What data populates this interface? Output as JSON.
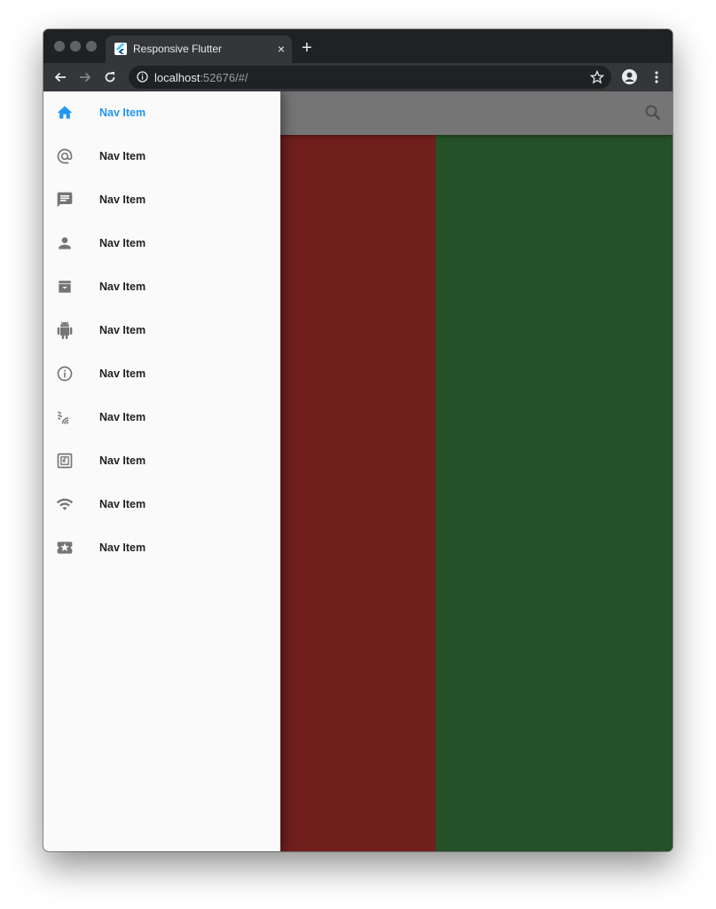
{
  "browser": {
    "tab_title": "Responsive Flutter",
    "tab_close": "×",
    "new_tab": "+",
    "url_host": "localhost",
    "url_rest": ":52676/#/"
  },
  "colors": {
    "accent": "#2196f3",
    "panel_red": "#701f1c",
    "panel_green": "#245127",
    "appbar": "#757575"
  },
  "drawer": {
    "items": [
      {
        "label": "Nav Item",
        "icon": "home-icon",
        "active": true
      },
      {
        "label": "Nav Item",
        "icon": "at-sign-icon"
      },
      {
        "label": "Nav Item",
        "icon": "chat-icon"
      },
      {
        "label": "Nav Item",
        "icon": "person-icon"
      },
      {
        "label": "Nav Item",
        "icon": "archive-icon"
      },
      {
        "label": "Nav Item",
        "icon": "android-icon"
      },
      {
        "label": "Nav Item",
        "icon": "info-icon"
      },
      {
        "label": "Nav Item",
        "icon": "nfc-rss-icon"
      },
      {
        "label": "Nav Item",
        "icon": "nfc-chip-icon"
      },
      {
        "label": "Nav Item",
        "icon": "wifi-icon"
      },
      {
        "label": "Nav Item",
        "icon": "ticket-icon"
      }
    ]
  }
}
